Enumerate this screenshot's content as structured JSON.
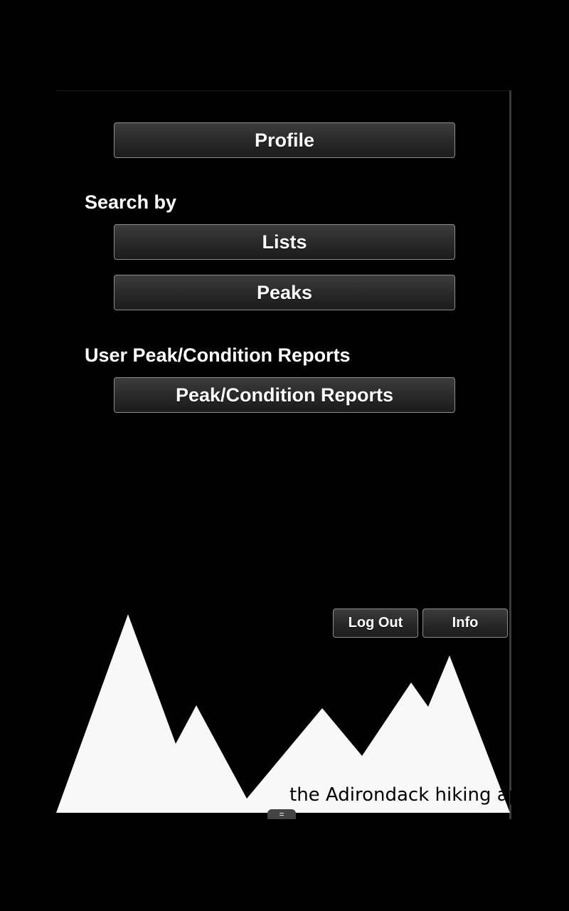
{
  "menu": {
    "profile_label": "Profile",
    "search_heading": "Search by",
    "lists_label": "Lists",
    "peaks_label": "Peaks",
    "reports_heading": "User Peak/Condition Reports",
    "reports_label": "Peak/Condition Reports"
  },
  "footer": {
    "logout_label": "Log Out",
    "info_label": "Info",
    "tagline": "the Adirondack hiking app",
    "handle_glyph": "="
  },
  "colors": {
    "background": "#000000",
    "button_text": "#ffffff",
    "button_border": "#8c8c8c",
    "logo_fill": "#f8f8f8"
  }
}
